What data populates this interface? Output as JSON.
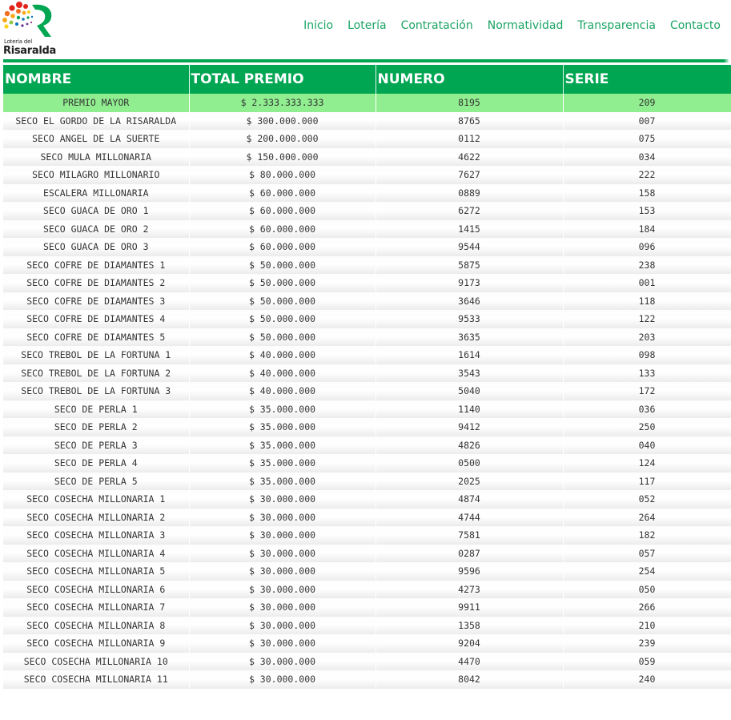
{
  "header": {
    "logo_line1": "Lotería del",
    "logo_line2": "Risaralda",
    "nav": [
      "Inicio",
      "Lotería",
      "Contratación",
      "Normatividad",
      "Transparencia",
      "Contacto"
    ]
  },
  "colors": {
    "accent": "#00a651",
    "highlight_row": "#90ee90",
    "nav_text": "#1aa463"
  },
  "table": {
    "headers": [
      "NOMBRE",
      "TOTAL PREMIO",
      "NUMERO",
      "SERIE"
    ],
    "rows": [
      [
        "PREMIO MAYOR",
        "$ 2.333.333.333",
        "8195",
        "209"
      ],
      [
        "SECO EL GORDO DE LA RISARALDA",
        "$ 300.000.000",
        "8765",
        "007"
      ],
      [
        "SECO ANGEL DE LA SUERTE",
        "$ 200.000.000",
        "0112",
        "075"
      ],
      [
        "SECO MULA MILLONARIA",
        "$ 150.000.000",
        "4622",
        "034"
      ],
      [
        "SECO MILAGRO MILLONARIO",
        "$ 80.000.000",
        "7627",
        "222"
      ],
      [
        "ESCALERA MILLONARIA",
        "$ 60.000.000",
        "0889",
        "158"
      ],
      [
        "SECO GUACA DE ORO 1",
        "$ 60.000.000",
        "6272",
        "153"
      ],
      [
        "SECO GUACA DE ORO 2",
        "$ 60.000.000",
        "1415",
        "184"
      ],
      [
        "SECO GUACA DE ORO 3",
        "$ 60.000.000",
        "9544",
        "096"
      ],
      [
        "SECO COFRE DE DIAMANTES 1",
        "$ 50.000.000",
        "5875",
        "238"
      ],
      [
        "SECO COFRE DE DIAMANTES 2",
        "$ 50.000.000",
        "9173",
        "001"
      ],
      [
        "SECO COFRE DE DIAMANTES 3",
        "$ 50.000.000",
        "3646",
        "118"
      ],
      [
        "SECO COFRE DE DIAMANTES 4",
        "$ 50.000.000",
        "9533",
        "122"
      ],
      [
        "SECO COFRE DE DIAMANTES 5",
        "$ 50.000.000",
        "3635",
        "203"
      ],
      [
        "SECO TREBOL DE LA FORTUNA 1",
        "$ 40.000.000",
        "1614",
        "098"
      ],
      [
        "SECO TREBOL DE LA FORTUNA 2",
        "$ 40.000.000",
        "3543",
        "133"
      ],
      [
        "SECO TREBOL DE LA FORTUNA 3",
        "$ 40.000.000",
        "5040",
        "172"
      ],
      [
        "SECO DE PERLA 1",
        "$ 35.000.000",
        "1140",
        "036"
      ],
      [
        "SECO DE PERLA 2",
        "$ 35.000.000",
        "9412",
        "250"
      ],
      [
        "SECO DE PERLA 3",
        "$ 35.000.000",
        "4826",
        "040"
      ],
      [
        "SECO DE PERLA 4",
        "$ 35.000.000",
        "0500",
        "124"
      ],
      [
        "SECO DE PERLA 5",
        "$ 35.000.000",
        "2025",
        "117"
      ],
      [
        "SECO COSECHA MILLONARIA 1",
        "$ 30.000.000",
        "4874",
        "052"
      ],
      [
        "SECO COSECHA MILLONARIA 2",
        "$ 30.000.000",
        "4744",
        "264"
      ],
      [
        "SECO COSECHA MILLONARIA 3",
        "$ 30.000.000",
        "7581",
        "182"
      ],
      [
        "SECO COSECHA MILLONARIA 4",
        "$ 30.000.000",
        "0287",
        "057"
      ],
      [
        "SECO COSECHA MILLONARIA 5",
        "$ 30.000.000",
        "9596",
        "254"
      ],
      [
        "SECO COSECHA MILLONARIA 6",
        "$ 30.000.000",
        "4273",
        "050"
      ],
      [
        "SECO COSECHA MILLONARIA 7",
        "$ 30.000.000",
        "9911",
        "266"
      ],
      [
        "SECO COSECHA MILLONARIA 8",
        "$ 30.000.000",
        "1358",
        "210"
      ],
      [
        "SECO COSECHA MILLONARIA 9",
        "$ 30.000.000",
        "9204",
        "239"
      ],
      [
        "SECO COSECHA MILLONARIA 10",
        "$ 30.000.000",
        "4470",
        "059"
      ],
      [
        "SECO COSECHA MILLONARIA 11",
        "$ 30.000.000",
        "8042",
        "240"
      ]
    ]
  }
}
